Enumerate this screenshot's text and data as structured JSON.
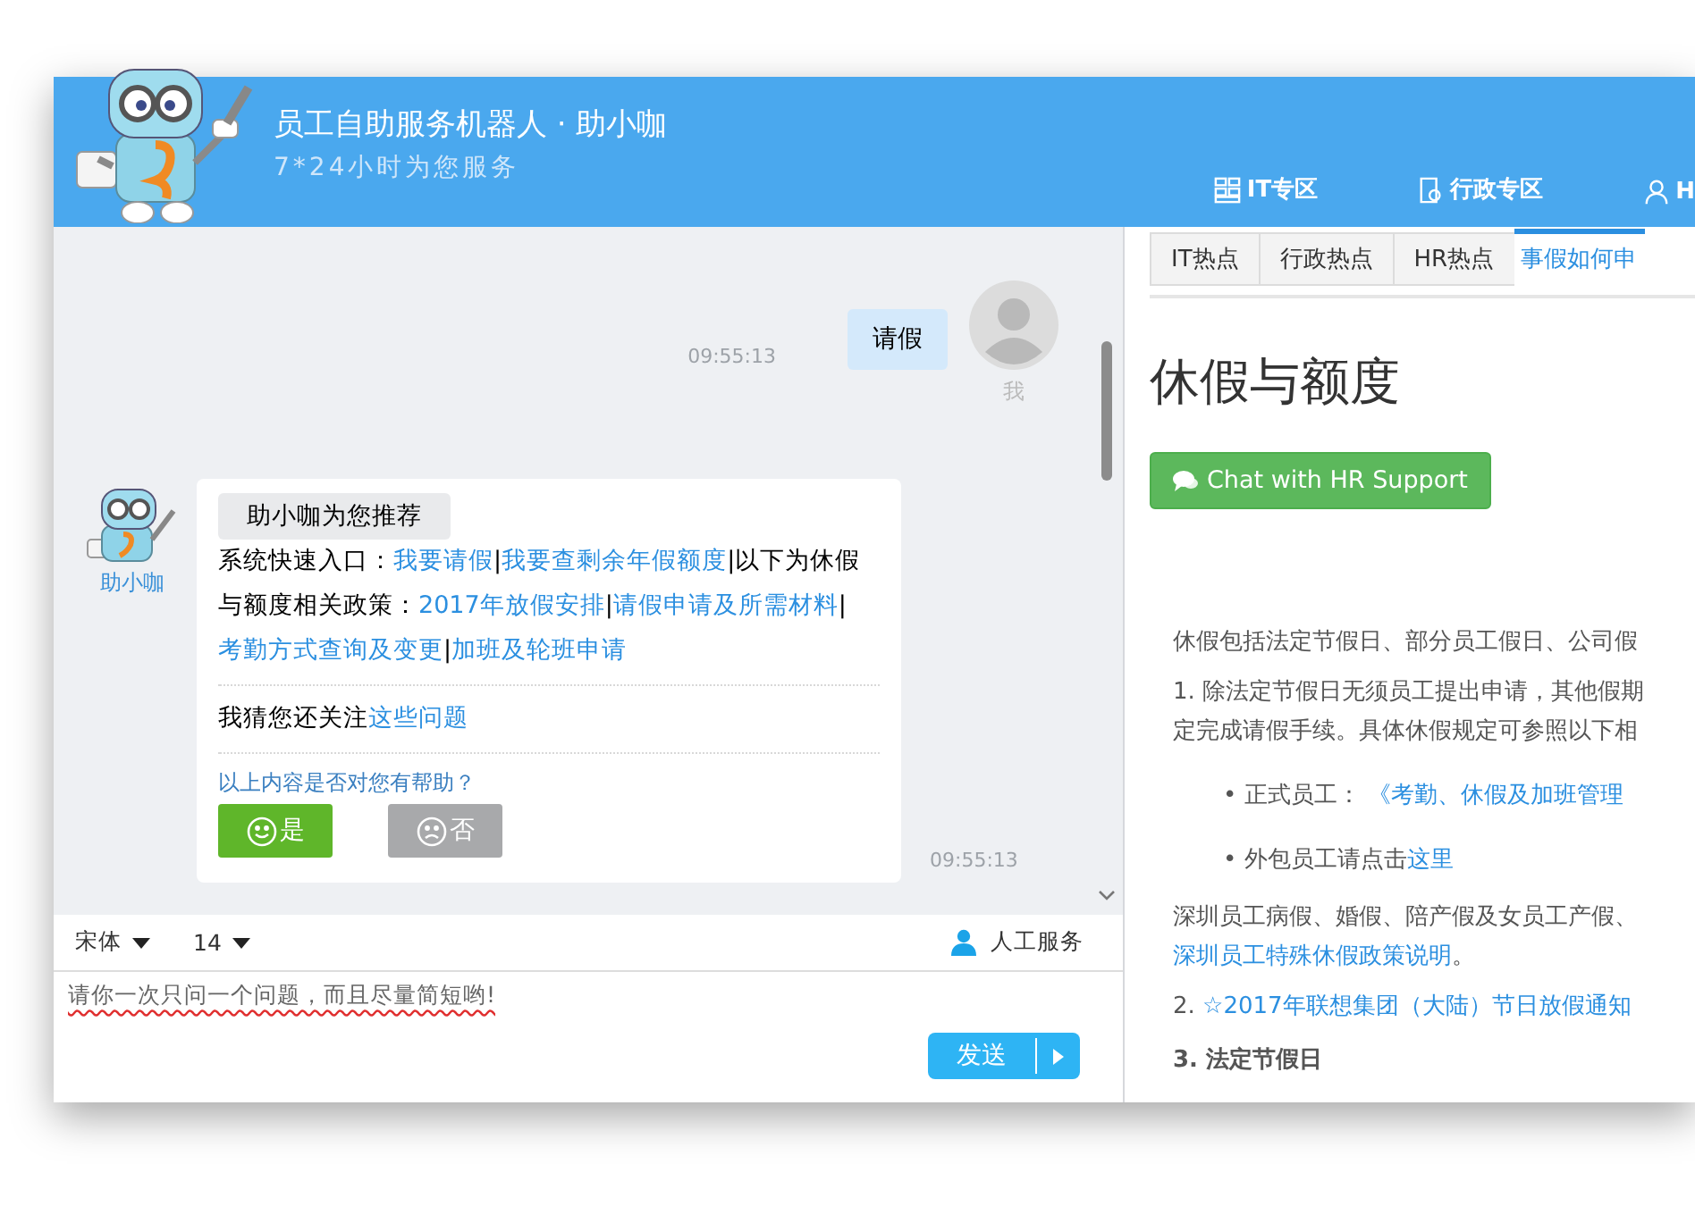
{
  "header": {
    "title": "员工自助服务机器人 · 助小咖",
    "subtitle": "7*24小时为您服务",
    "nav": [
      {
        "kind": "grid",
        "label": "IT专区"
      },
      {
        "kind": "doc",
        "label": "行政专区"
      },
      {
        "kind": "person",
        "label": "H"
      }
    ]
  },
  "chat": {
    "messages": [
      {
        "kind": "user",
        "text": "请假",
        "time": "09:55:13",
        "sender": "我"
      },
      {
        "kind": "bot",
        "sender": "助小咖",
        "time": "09:55:13",
        "heading": "助小咖为您推荐",
        "body": [
          {
            "text": "系统快速入口：",
            "link": false
          },
          {
            "text": "我要请假",
            "link": true
          },
          {
            "text": "|",
            "link": false
          },
          {
            "text": "我要查剩余年假额度",
            "link": true
          },
          {
            "text": "|以下为休假与额度相关政策：",
            "link": false
          },
          {
            "text": "2017年放假安排",
            "link": true
          },
          {
            "text": "|",
            "link": false
          },
          {
            "text": "请假申请及所需材料",
            "link": true
          },
          {
            "text": "|",
            "link": false
          },
          {
            "text": "考勤方式查询及变更",
            "link": true
          },
          {
            "text": "|",
            "link": false
          },
          {
            "text": "加班及轮班申请",
            "link": true
          }
        ],
        "followup": [
          {
            "text": "我猜您还关注",
            "link": false
          },
          {
            "text": "这些问题",
            "link": true
          }
        ],
        "question": "以上内容是否对您有帮助？",
        "buttons": [
          {
            "kind": "yes",
            "label": "是"
          },
          {
            "kind": "no",
            "label": "否"
          }
        ]
      }
    ]
  },
  "toolbar": {
    "font": "宋体",
    "size": "14",
    "agent": "人工服务"
  },
  "input": {
    "value": "请你一次只问一个问题，而且尽量简短哟!"
  },
  "send": "发送",
  "article": {
    "tabs": [
      {
        "label": "IT热点",
        "selected": false
      },
      {
        "label": "行政热点",
        "selected": false
      },
      {
        "label": "HR热点",
        "selected": false
      },
      {
        "label": "事假如何申",
        "selected": true
      }
    ],
    "heading": "休假与额度",
    "chat_button": "Chat with HR Support",
    "paragraphs": [
      {
        "kind": "p",
        "parts": [
          {
            "text": "休假包括法定节假日、部分员工假日、公司假",
            "link": false
          }
        ]
      },
      {
        "kind": "p",
        "parts": [
          {
            "text": "1. 除法定节假日无须员工提出申请，其他假期",
            "link": false
          }
        ]
      },
      {
        "kind": "line",
        "parts": [
          {
            "text": "定完成请假手续。具体休假规定可参照以下相",
            "link": false
          }
        ]
      },
      {
        "kind": "bullet",
        "marker": "•",
        "parts": [
          {
            "text": "正式员工： ",
            "link": false
          },
          {
            "text": "《考勤、休假及加班管理",
            "link": true
          }
        ]
      },
      {
        "kind": "bullet",
        "marker": "•",
        "parts": [
          {
            "text": "外包员工请点击",
            "link": false
          },
          {
            "text": "这里",
            "link": true
          }
        ]
      },
      {
        "kind": "p",
        "parts": [
          {
            "text": "深圳员工病假、婚假、陪产假及女员工产假、",
            "link": false
          }
        ]
      },
      {
        "kind": "line",
        "parts": [
          {
            "text": "深圳员工特殊休假政策说明",
            "link": true
          },
          {
            "text": "。",
            "link": false
          }
        ]
      },
      {
        "kind": "p",
        "parts": [
          {
            "text": "2. ",
            "link": false
          },
          {
            "text": "☆2017年联想集团（大陆）节日放假通知",
            "link": true
          }
        ]
      },
      {
        "kind": "bold",
        "parts": [
          {
            "text": "3. 法定节假日",
            "link": false
          }
        ]
      }
    ]
  }
}
